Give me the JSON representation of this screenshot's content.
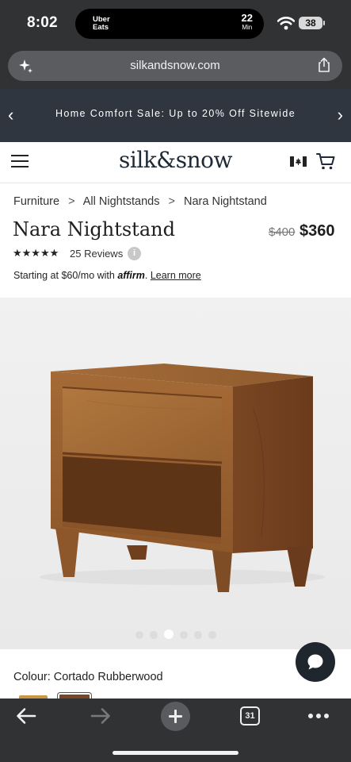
{
  "status_bar": {
    "time": "8:02",
    "live_activity": {
      "app": "Uber Eats",
      "app_line1": "Uber",
      "app_line2": "Eats",
      "eta_value": "22",
      "eta_unit": "Min"
    },
    "battery_level": "38"
  },
  "browser": {
    "url": "silkandsnow.com",
    "tab_count": "31"
  },
  "promo_banner": {
    "text": "Home Comfort Sale: Up to 20% Off Sitewide",
    "prev_glyph": "‹",
    "next_glyph": "›"
  },
  "header": {
    "logo": "silk&snow"
  },
  "breadcrumb": {
    "items": [
      "Furniture",
      "All Nightstands",
      "Nara Nightstand"
    ],
    "separator": ">"
  },
  "product": {
    "title": "Nara Nightstand",
    "price_original": "$400",
    "price_sale": "$360",
    "rating_stars": "★★★★★",
    "rating_value": 5,
    "reviews": "25 Reviews",
    "info_glyph": "i",
    "financing_prefix": "Starting at $60/mo with ",
    "financing_brand": "affirm",
    "financing_period": ".",
    "financing_link": "Learn more",
    "colour_label": "Colour: Cortado Rubberwood",
    "gallery_active_index": 2,
    "gallery_count": 6
  },
  "colors": {
    "chrome": "#303234",
    "promo_bg": "#2f3640",
    "logo": "#1f2a37",
    "wood": "#8b5529",
    "swatch_natural": "#c99847",
    "swatch_cortado": "#7a4426"
  },
  "icons": [
    "wifi-icon",
    "sparkle-icon",
    "share-icon",
    "menu-icon",
    "canada-flag-icon",
    "cart-icon",
    "info-icon",
    "chat-icon",
    "back-arrow-icon",
    "forward-arrow-icon",
    "plus-icon",
    "more-icon"
  ]
}
